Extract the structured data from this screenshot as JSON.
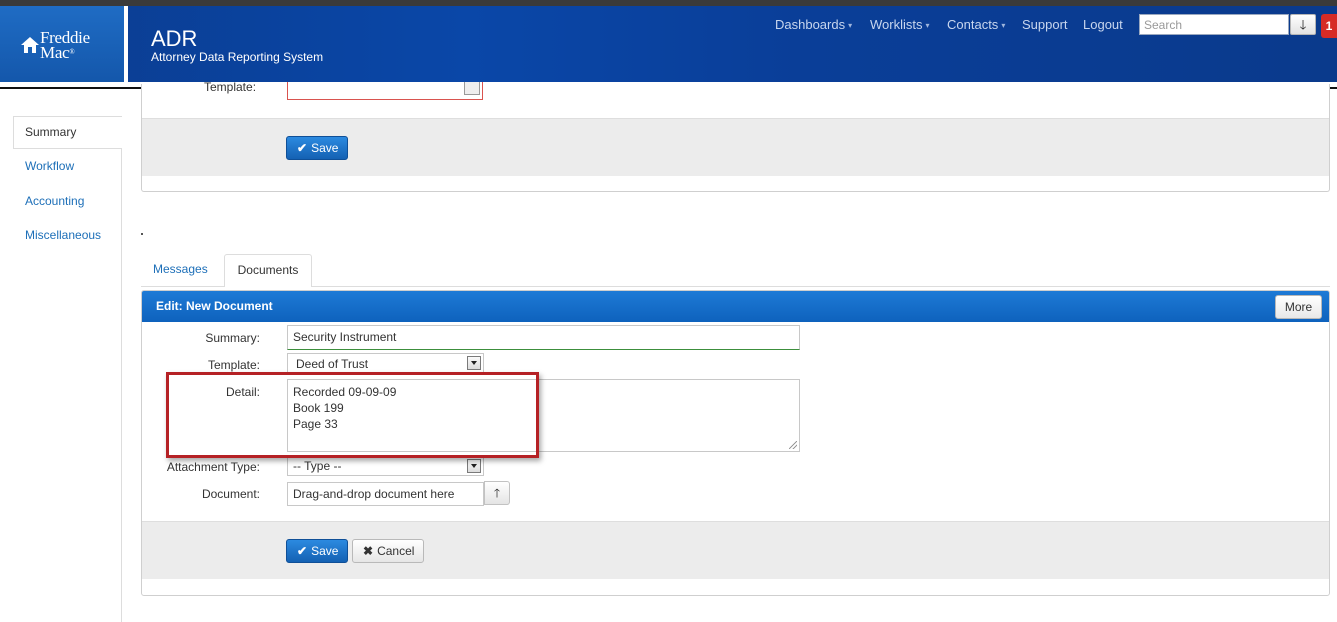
{
  "brand": {
    "logo_line1": "Freddie",
    "logo_line2": "Mac",
    "logo_reg": "®",
    "app_title": "ADR",
    "app_subtitle": "Attorney Data Reporting System"
  },
  "nav": {
    "items": [
      {
        "label": "Dashboards",
        "dropdown": true
      },
      {
        "label": "Worklists",
        "dropdown": true
      },
      {
        "label": "Contacts",
        "dropdown": true
      },
      {
        "label": "Support",
        "dropdown": false
      },
      {
        "label": "Logout",
        "dropdown": false
      }
    ],
    "caret": "▾",
    "search_placeholder": "Search",
    "search_button_icon": "arrow-down-icon",
    "search_button_glyph": "🡓",
    "notification_count": "1"
  },
  "sidebar": {
    "items": [
      {
        "label": "Summary",
        "active": true
      },
      {
        "label": "Workflow",
        "active": false
      },
      {
        "label": "Accounting",
        "active": false
      },
      {
        "label": "Miscellaneous",
        "active": false
      }
    ]
  },
  "top_panel": {
    "template_label": "Template:",
    "save_label": "Save",
    "save_icon": "✔"
  },
  "tabs": {
    "messages": "Messages",
    "documents": "Documents"
  },
  "document_form": {
    "header_title": "Edit: New Document",
    "more_label": "More",
    "summary_label": "Summary:",
    "summary_value": "Security Instrument",
    "template_label": "Template:",
    "template_value": "Deed of Trust",
    "detail_label": "Detail:",
    "detail_lines": [
      "Recorded 09-09-09",
      "Book 199",
      "Page 33"
    ],
    "attachment_label": "Attachment Type:",
    "attachment_value": "-- Type --",
    "document_label": "Document:",
    "document_placeholder": "Drag-and-drop document here",
    "upload_icon": "arrow-up-icon",
    "upload_glyph": "🡑",
    "save_label": "Save",
    "save_icon": "✔",
    "cancel_label": "Cancel",
    "cancel_icon": "✖"
  },
  "colors": {
    "header_blue": "#0a47a8",
    "panel_header_blue": "#1a72cc",
    "link_blue": "#1d6fb8",
    "highlight_red": "#b52125",
    "notification_red": "#d62b26"
  }
}
